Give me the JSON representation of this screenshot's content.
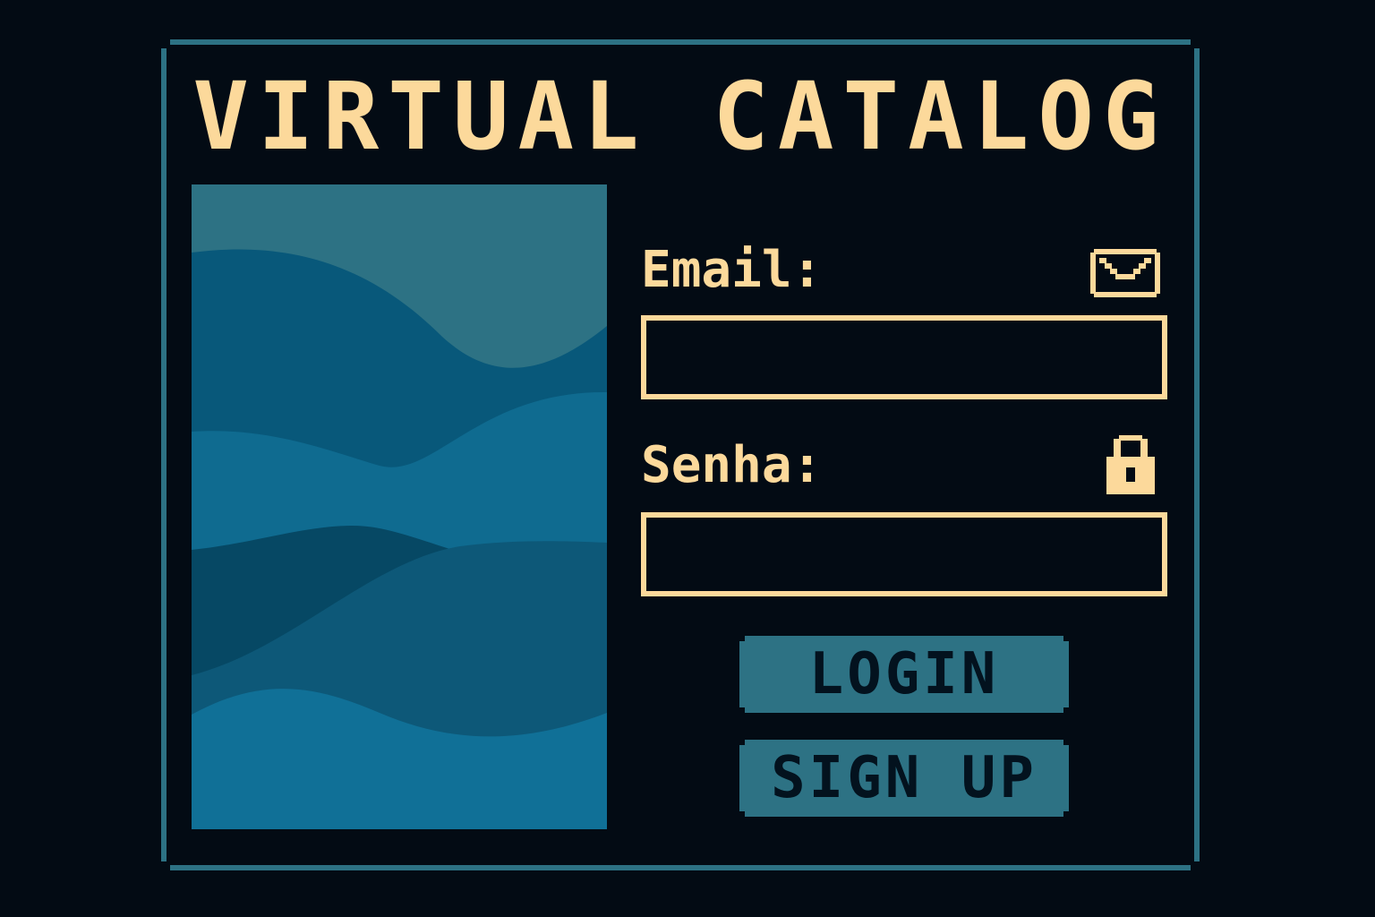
{
  "title": "VIRTUAL CATALOG",
  "form": {
    "email_label": "Email:",
    "email_value": "",
    "email_placeholder": "",
    "email_icon": "mail-icon",
    "senha_label": "Senha:",
    "senha_value": "",
    "senha_placeholder": "",
    "senha_icon": "lock-icon"
  },
  "buttons": {
    "login_label": "LOGIN",
    "signup_label": "SIGN UP"
  },
  "colors": {
    "background": "#030b14",
    "frame": "#2d7284",
    "text_accent": "#fcd99b",
    "button_bg": "#2d7284",
    "button_text": "#03121e"
  }
}
